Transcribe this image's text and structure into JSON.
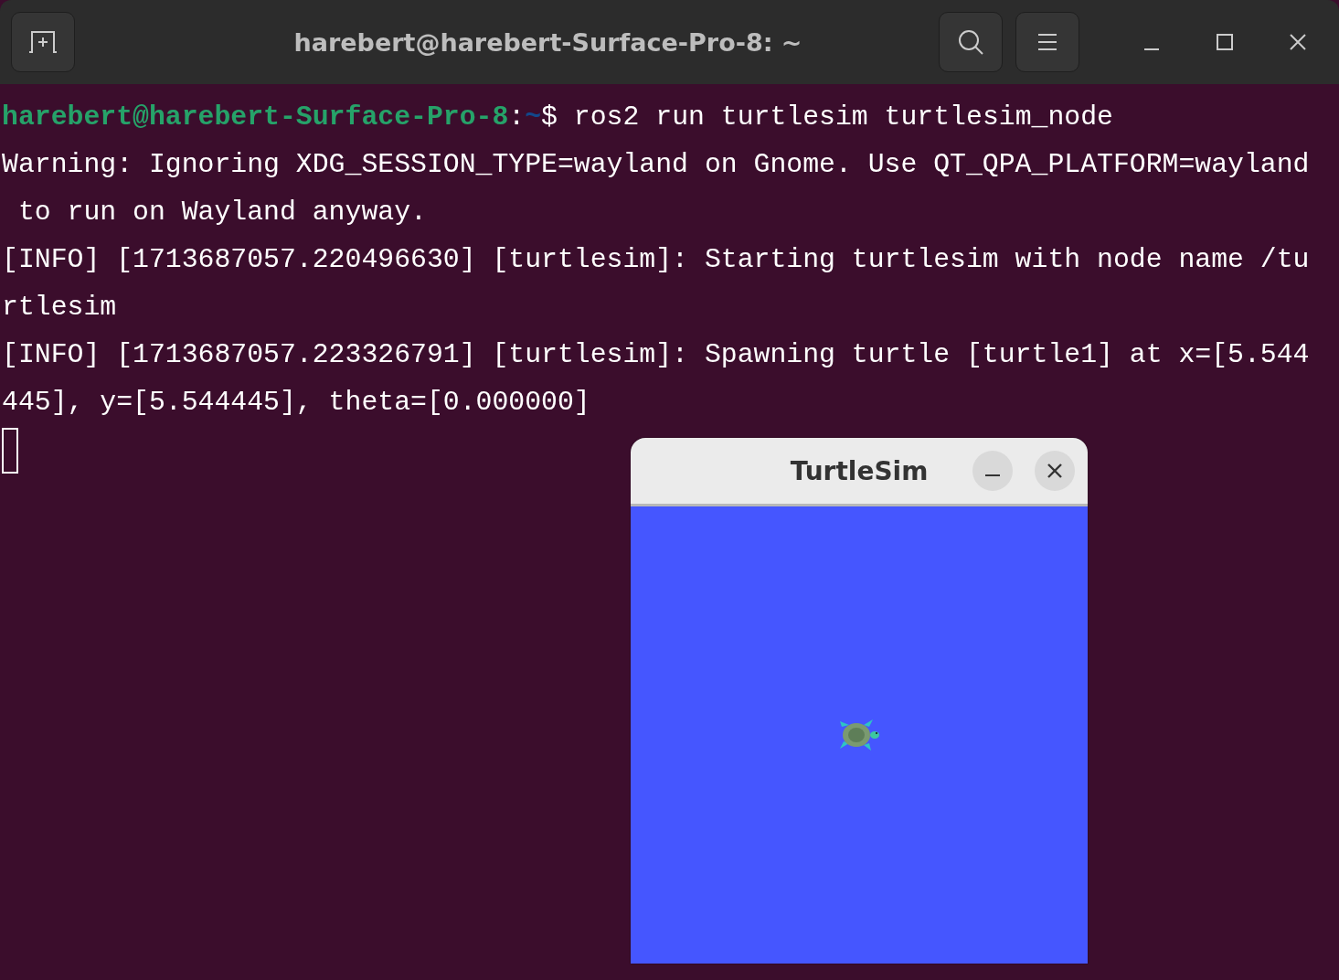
{
  "terminal": {
    "title": "harebert@harebert-Surface-Pro-8: ~",
    "lines": [
      {
        "kind": "prompt",
        "user_host": "harebert@harebert-Surface-Pro-8",
        "separator": ":",
        "path": "~",
        "command": "$ ros2 run turtlesim turtlesim_node"
      },
      {
        "kind": "output",
        "text": "Warning: Ignoring XDG_SESSION_TYPE=wayland on Gnome. Use QT_QPA_PLATFORM=wayland"
      },
      {
        "kind": "output",
        "text": " to run on Wayland anyway."
      },
      {
        "kind": "output",
        "text": "[INFO] [1713687057.220496630] [turtlesim]: Starting turtlesim with node name /tu"
      },
      {
        "kind": "output",
        "text": "rtlesim"
      },
      {
        "kind": "output",
        "text": "[INFO] [1713687057.223326791] [turtlesim]: Spawning turtle [turtle1] at x=[5.544"
      },
      {
        "kind": "output",
        "text": "445], y=[5.544445], theta=[0.000000]"
      }
    ]
  },
  "turtlesim": {
    "title": "TurtleSim"
  }
}
